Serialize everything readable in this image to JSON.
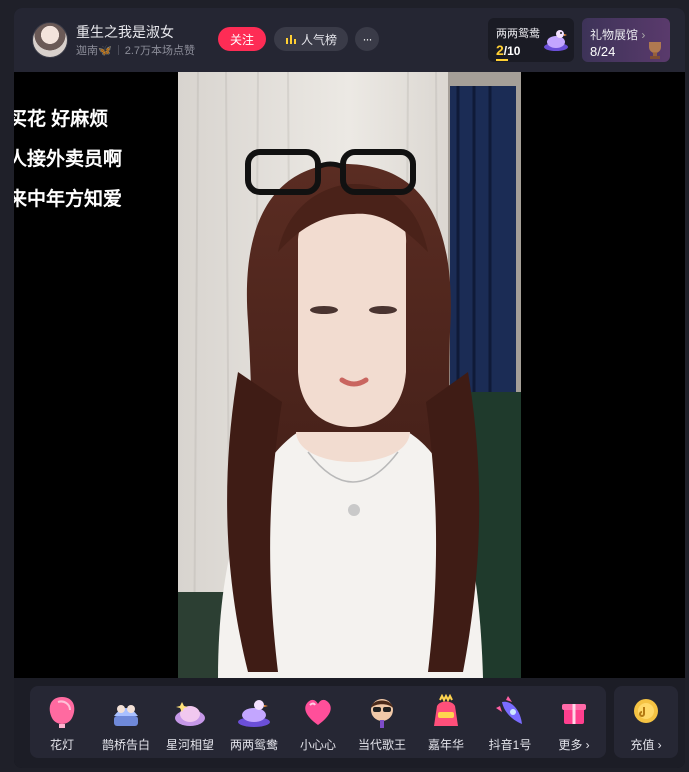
{
  "header": {
    "streamer_name": "重生之我是淑女",
    "streamer_location": "迦南🦋",
    "likes_text": "2.7万本场点赞",
    "follow_label": "关注",
    "rank_label": "人气榜",
    "more_label": "···"
  },
  "gift_task": {
    "title": "两两鸳鸯",
    "current": "2",
    "total": "/10"
  },
  "gift_gallery": {
    "title": "礼物展馆",
    "arrow": "›",
    "count": "8/24"
  },
  "scrolling_comments": [
    "买花 好麻烦",
    "人接外卖员啊",
    "来中年方知爱"
  ],
  "gift_bar": {
    "items": [
      {
        "label": "花灯",
        "icon": "lantern-icon"
      },
      {
        "label": "鹊桥告白",
        "icon": "bridge-icon"
      },
      {
        "label": "星河相望",
        "icon": "galaxy-icon"
      },
      {
        "label": "两两鸳鸯",
        "icon": "duck-icon"
      },
      {
        "label": "小心心",
        "icon": "heart-icon"
      },
      {
        "label": "当代歌王",
        "icon": "singer-icon"
      },
      {
        "label": "嘉年华",
        "icon": "carnival-icon"
      },
      {
        "label": "抖音1号",
        "icon": "rocket-icon"
      },
      {
        "label": "更多 ›",
        "icon": "gift-box-icon"
      }
    ],
    "recharge_label": "充值 ›"
  },
  "colors": {
    "follow": "#fe2c55",
    "accent_yellow": "#ffcf33",
    "background": "#15161d"
  }
}
